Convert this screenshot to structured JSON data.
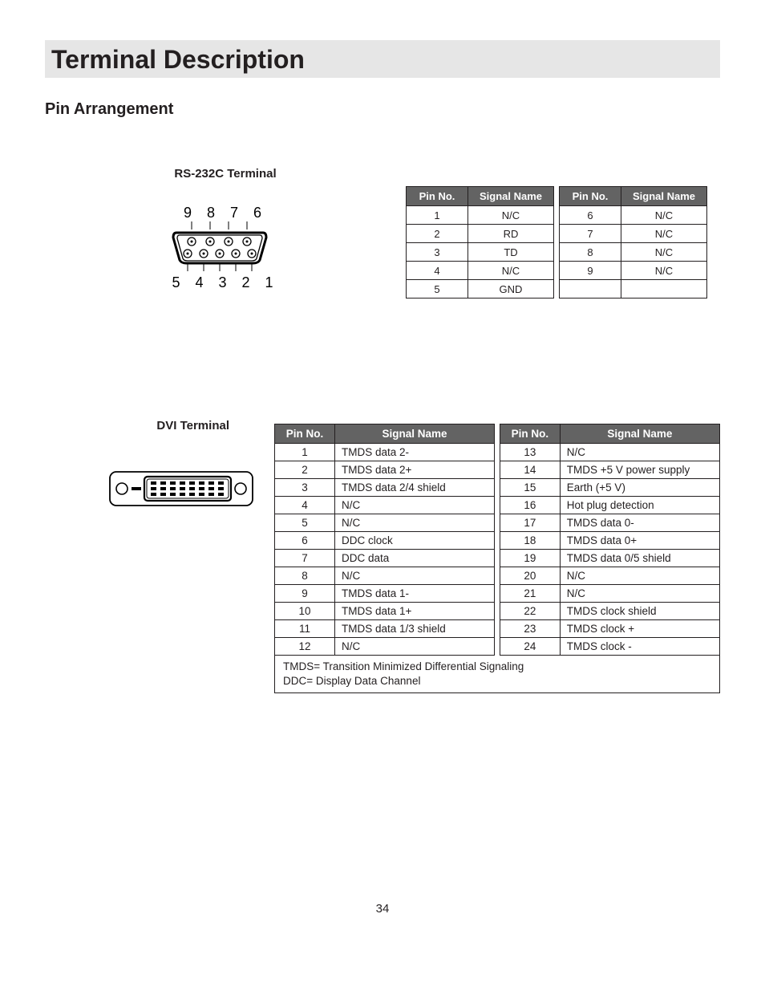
{
  "title": "Terminal Description",
  "subheading": "Pin Arrangement",
  "rs232": {
    "label": "RS-232C Terminal",
    "top_pins": "9 8 7 6",
    "bottom_pins": "5 4 3 2 1",
    "headers": {
      "pin": "Pin No.",
      "signal": "Signal Name"
    },
    "left_rows": [
      {
        "pin": "1",
        "signal": "N/C"
      },
      {
        "pin": "2",
        "signal": "RD"
      },
      {
        "pin": "3",
        "signal": "TD"
      },
      {
        "pin": "4",
        "signal": "N/C"
      },
      {
        "pin": "5",
        "signal": "GND"
      }
    ],
    "right_rows": [
      {
        "pin": "6",
        "signal": "N/C"
      },
      {
        "pin": "7",
        "signal": "N/C"
      },
      {
        "pin": "8",
        "signal": "N/C"
      },
      {
        "pin": "9",
        "signal": "N/C"
      },
      {
        "pin": "",
        "signal": ""
      }
    ]
  },
  "dvi": {
    "label": "DVI Terminal",
    "headers": {
      "pin": "Pin No.",
      "signal": "Signal Name"
    },
    "left_rows": [
      {
        "pin": "1",
        "signal": "TMDS data 2-"
      },
      {
        "pin": "2",
        "signal": "TMDS data 2+"
      },
      {
        "pin": "3",
        "signal": "TMDS data 2/4 shield"
      },
      {
        "pin": "4",
        "signal": "N/C"
      },
      {
        "pin": "5",
        "signal": "N/C"
      },
      {
        "pin": "6",
        "signal": "DDC clock"
      },
      {
        "pin": "7",
        "signal": "DDC data"
      },
      {
        "pin": "8",
        "signal": "N/C"
      },
      {
        "pin": "9",
        "signal": "TMDS data 1-"
      },
      {
        "pin": "10",
        "signal": "TMDS data 1+"
      },
      {
        "pin": "11",
        "signal": "TMDS data 1/3 shield"
      },
      {
        "pin": "12",
        "signal": "N/C"
      }
    ],
    "right_rows": [
      {
        "pin": "13",
        "signal": "N/C"
      },
      {
        "pin": "14",
        "signal": "TMDS +5 V power supply"
      },
      {
        "pin": "15",
        "signal": "Earth (+5 V)"
      },
      {
        "pin": "16",
        "signal": "Hot plug detection"
      },
      {
        "pin": "17",
        "signal": "TMDS data 0-"
      },
      {
        "pin": "18",
        "signal": "TMDS data 0+"
      },
      {
        "pin": "19",
        "signal": "TMDS data 0/5 shield"
      },
      {
        "pin": "20",
        "signal": "N/C"
      },
      {
        "pin": "21",
        "signal": "N/C"
      },
      {
        "pin": "22",
        "signal": "TMDS clock shield"
      },
      {
        "pin": "23",
        "signal": "TMDS clock +"
      },
      {
        "pin": "24",
        "signal": "TMDS clock -"
      }
    ],
    "footnote_line1": "TMDS= Transition Minimized Differential Signaling",
    "footnote_line2": "DDC= Display Data Channel"
  },
  "page_number": "34"
}
